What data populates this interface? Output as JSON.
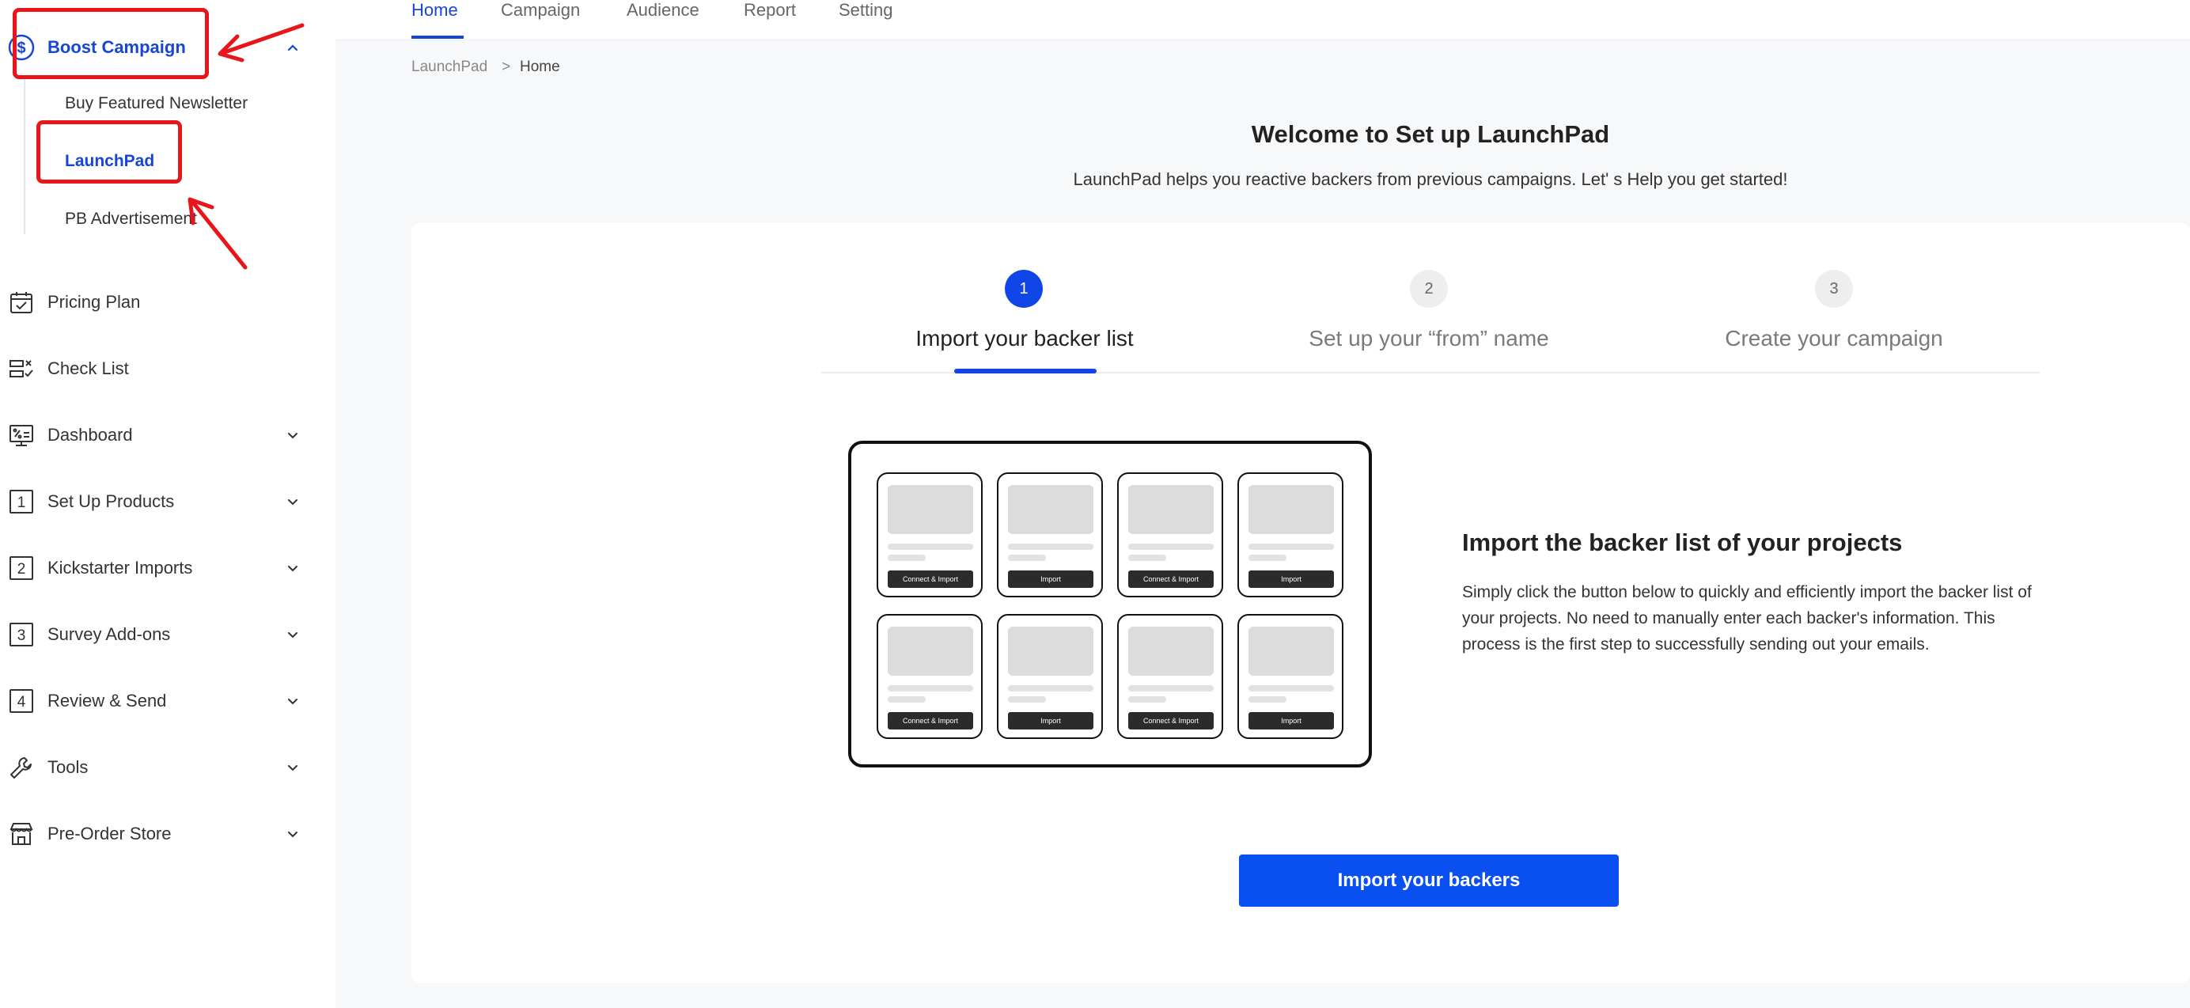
{
  "sidebar": {
    "boost": {
      "label": "Boost Campaign",
      "icon": "dollar-circle-icon",
      "expanded": true
    },
    "sub_items": [
      {
        "label": "Buy Featured Newsletter"
      },
      {
        "label": "LaunchPad",
        "active": true
      },
      {
        "label": "PB Advertisement"
      }
    ],
    "items": [
      {
        "label": "Pricing Plan",
        "icon": "calendar-check-icon"
      },
      {
        "label": "Check List",
        "icon": "checklist-icon"
      },
      {
        "label": "Dashboard",
        "icon": "monitor-chart-icon"
      },
      {
        "label": "Set Up Products",
        "icon": "number-1-icon"
      },
      {
        "label": "Kickstarter Imports",
        "icon": "number-2-icon"
      },
      {
        "label": "Survey Add-ons",
        "icon": "number-3-icon"
      },
      {
        "label": "Review & Send",
        "icon": "number-4-icon"
      },
      {
        "label": "Tools",
        "icon": "wrench-icon"
      },
      {
        "label": "Pre-Order Store",
        "icon": "storefront-icon"
      }
    ]
  },
  "top_tabs": [
    {
      "label": "Home",
      "active": true
    },
    {
      "label": "Campaign"
    },
    {
      "label": "Audience"
    },
    {
      "label": "Report"
    },
    {
      "label": "Setting"
    }
  ],
  "breadcrumb": {
    "root": "LaunchPad",
    "separator": ">",
    "current": "Home"
  },
  "welcome": {
    "title": "Welcome to Set up LaunchPad",
    "subtitle": "LaunchPad helps you reactive backers from previous campaigns. Let' s Help you get started!"
  },
  "steps": [
    {
      "number": "1",
      "label": "Import your backer list",
      "active": true
    },
    {
      "number": "2",
      "label": "Set up your “from” name"
    },
    {
      "number": "3",
      "label": "Create your campaign"
    }
  ],
  "illustration": {
    "cards": [
      {
        "button": "Connect & Import"
      },
      {
        "button": "Import"
      },
      {
        "button": "Connect & Import"
      },
      {
        "button": "Import"
      },
      {
        "button": "Connect & Import"
      },
      {
        "button": "Import"
      },
      {
        "button": "Connect & Import"
      },
      {
        "button": "Import"
      }
    ]
  },
  "import_section": {
    "title": "Import the backer list of your projects",
    "body": "Simply click the button below to quickly and efficiently import the backer list of your projects. No need to manually enter each backer's information. This process is the first step to successfully sending out your emails.",
    "cta": "Import your backers"
  },
  "colors": {
    "accent": "#1746d6",
    "primary_button": "#0a4ff0",
    "annotation_red": "#e8151b"
  }
}
